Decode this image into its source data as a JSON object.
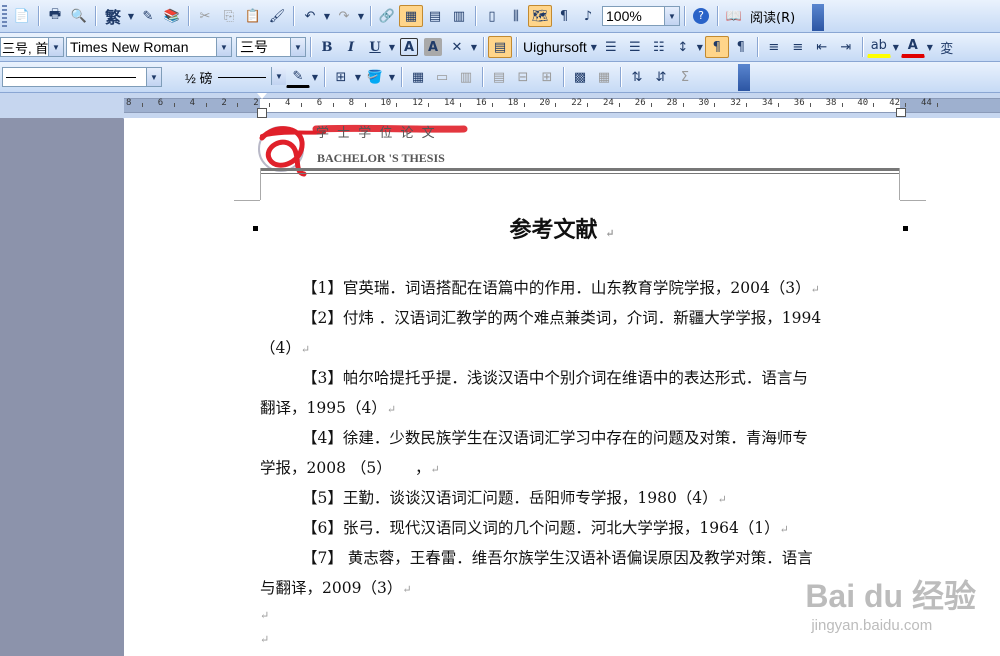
{
  "toolbar_standard": {
    "traditional_chinese": "繁",
    "zoom": "100%",
    "read_mode": "阅读(R)"
  },
  "toolbar_format": {
    "style": "三号, 首",
    "font": "Times New Roman",
    "size": "三号",
    "bold": "B",
    "italic": "I",
    "underline": "U",
    "char_border": "A",
    "char_shade": "A",
    "script_font": "Uighursoft"
  },
  "toolbar_tables": {
    "line_weight": "½ 磅",
    "sum": "Σ"
  },
  "ruler": {
    "labels": [
      "8",
      "6",
      "4",
      "2",
      "2",
      "4",
      "6",
      "8",
      "10",
      "12",
      "14",
      "16",
      "18",
      "20",
      "22",
      "24",
      "26",
      "28",
      "30",
      "32",
      "34",
      "36",
      "38",
      "40",
      "42",
      "44"
    ]
  },
  "document": {
    "header_school": "学 士 学 位 论 文",
    "header_subtitle": "BACHELOR 'S THESIS",
    "title": "参考文献",
    "references": [
      {
        "line1": "【1】官英瑞．词语搭配在语篇中的作用．山东教育学院学报，2004（3）",
        "line2": ""
      },
      {
        "line1": "【2】付炜 ．汉语词汇教学的两个难点兼类词，介词．新疆大学学报，1994",
        "line2": "（4）"
      },
      {
        "line1": "【3】帕尔哈提托乎提．浅谈汉语中个别介词在维语中的表达形式．语言与",
        "line2": "翻译，1995（4）"
      },
      {
        "line1": "【4】徐建．少数民族学生在汉语词汇学习中存在的问题及对策．青海师专",
        "line2": "学报，2008 （5）　　，"
      },
      {
        "line1": "【5】王勤．谈谈汉语词汇问题．岳阳师专学报，1980（4）",
        "line2": ""
      },
      {
        "line1": "【6】张弓．现代汉语同义词的几个问题．河北大学学报，1964（1）",
        "line2": ""
      },
      {
        "line1": "【7】 黄志蓉，王春雷．维吾尔族学生汉语补语偏误原因及教学对策．语言",
        "line2": "与翻译，2009（3）"
      }
    ],
    "paragraph_mark": "↵"
  },
  "watermark": {
    "brand": "Bai du 经验",
    "url": "jingyan.baidu.com"
  },
  "colors": {
    "toolbar_top": "#eaf2fd",
    "toolbar_bottom": "#c6daf5",
    "active_button": "#ffd58a",
    "left_pane": "#8c93ab",
    "red_scribble": "#e0202a"
  }
}
